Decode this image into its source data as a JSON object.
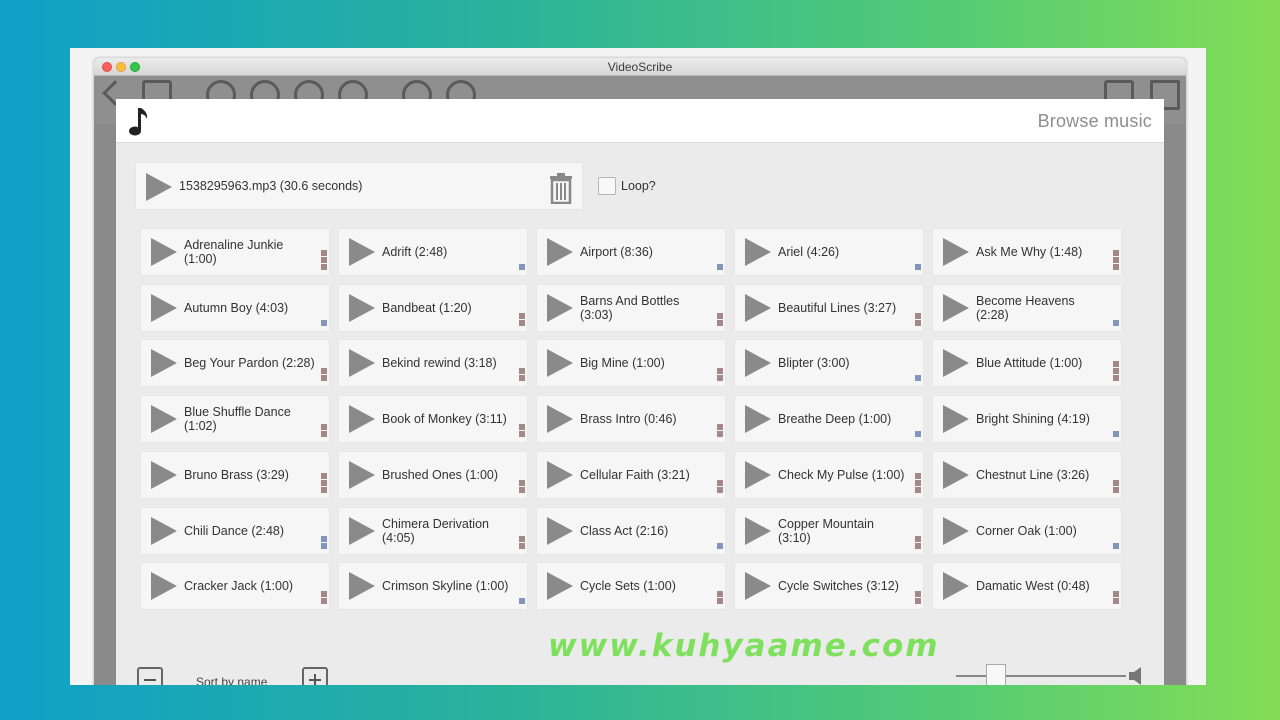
{
  "window": {
    "title": "VideoScribe"
  },
  "dialog": {
    "title": "Browse music",
    "current_track": "1538295963.mp3 (30.6 seconds)",
    "loop_label": "Loop?",
    "sort_label": "Sort by name"
  },
  "tracks": [
    {
      "label": "Adrenaline Junkie (1:00)",
      "bars": "red3"
    },
    {
      "label": "Adrift (2:48)",
      "bars": "blue1"
    },
    {
      "label": "Airport (8:36)",
      "bars": "blue1"
    },
    {
      "label": "Ariel (4:26)",
      "bars": "blue1"
    },
    {
      "label": "Ask Me Why (1:48)",
      "bars": "red3"
    },
    {
      "label": "Autumn Boy (4:03)",
      "bars": "blue1"
    },
    {
      "label": "Bandbeat (1:20)",
      "bars": "red2"
    },
    {
      "label": "Barns And Bottles (3:03)",
      "bars": "red2"
    },
    {
      "label": "Beautiful Lines (3:27)",
      "bars": "red2"
    },
    {
      "label": "Become Heavens (2:28)",
      "bars": "blue1"
    },
    {
      "label": "Beg Your Pardon (2:28)",
      "bars": "red2"
    },
    {
      "label": "Bekind rewind (3:18)",
      "bars": "red2"
    },
    {
      "label": "Big Mine (1:00)",
      "bars": "red2"
    },
    {
      "label": "Blipter (3:00)",
      "bars": "blue1"
    },
    {
      "label": "Blue Attitude (1:00)",
      "bars": "red3"
    },
    {
      "label": "Blue Shuffle Dance (1:02)",
      "bars": "red2"
    },
    {
      "label": "Book of Monkey (3:11)",
      "bars": "red2"
    },
    {
      "label": "Brass Intro (0:46)",
      "bars": "red2"
    },
    {
      "label": "Breathe Deep (1:00)",
      "bars": "blue1"
    },
    {
      "label": "Bright Shining (4:19)",
      "bars": "blue1"
    },
    {
      "label": "Bruno Brass (3:29)",
      "bars": "red3"
    },
    {
      "label": "Brushed Ones (1:00)",
      "bars": "red2"
    },
    {
      "label": "Cellular Faith (3:21)",
      "bars": "red2"
    },
    {
      "label": "Check My Pulse (1:00)",
      "bars": "red3"
    },
    {
      "label": "Chestnut Line (3:26)",
      "bars": "red2"
    },
    {
      "label": "Chili Dance (2:48)",
      "bars": "blue2"
    },
    {
      "label": "Chimera Derivation (4:05)",
      "bars": "red2"
    },
    {
      "label": "Class Act (2:16)",
      "bars": "blue1"
    },
    {
      "label": "Copper Mountain (3:10)",
      "bars": "red2"
    },
    {
      "label": "Corner Oak (1:00)",
      "bars": "blue1"
    },
    {
      "label": "Cracker Jack (1:00)",
      "bars": "red2"
    },
    {
      "label": "Crimson Skyline (1:00)",
      "bars": "blue1"
    },
    {
      "label": "Cycle Sets (1:00)",
      "bars": "red2"
    },
    {
      "label": "Cycle Switches (3:12)",
      "bars": "red2"
    },
    {
      "label": "Damatic West (0:48)",
      "bars": "red2"
    }
  ],
  "watermark": "www.kuhyaame.com",
  "colors": {
    "bar_red": "#a48888",
    "bar_blue": "#8495bc",
    "play": "#8a8a8a"
  }
}
